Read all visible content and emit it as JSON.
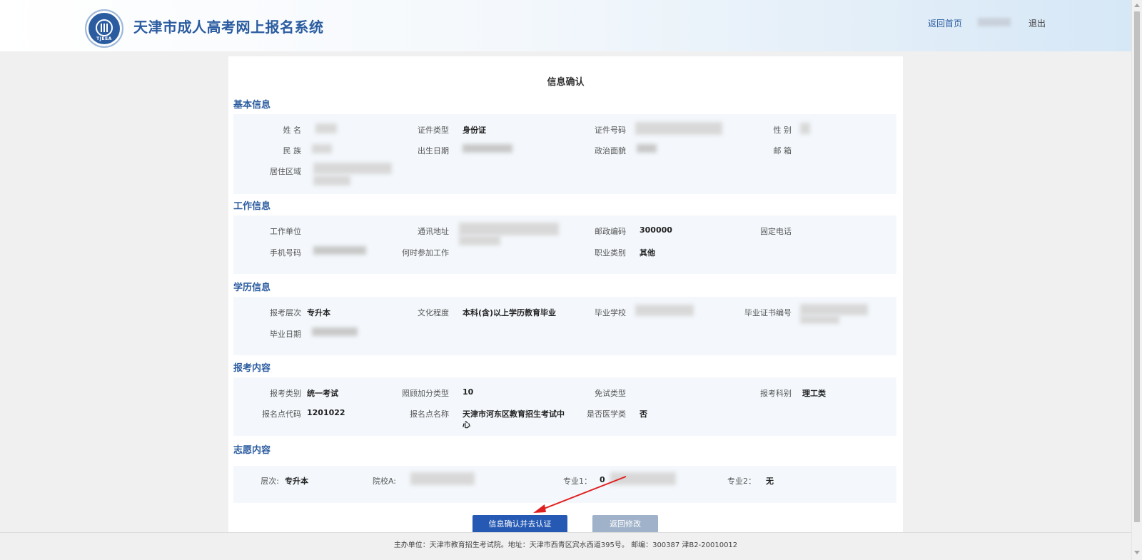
{
  "header": {
    "logo_text": "TJEEA",
    "title": "天津市成人高考网上报名系统",
    "home_link": "返回首页",
    "logout_link": "退出"
  },
  "page_title": "信息确认",
  "basic": {
    "title": "基本信息",
    "name_label": "姓 名",
    "id_type_label": "证件类型",
    "id_type_value": "身份证",
    "id_number_label": "证件号码",
    "gender_label": "性 别",
    "ethnicity_label": "民 族",
    "birth_label": "出生日期",
    "political_label": "政治面貌",
    "email_label": "邮 箱",
    "region_label": "居住区域"
  },
  "work": {
    "title": "工作信息",
    "employer_label": "工作单位",
    "address_label": "通讯地址",
    "postcode_label": "邮政编码",
    "postcode_value": "300000",
    "landline_label": "固定电话",
    "mobile_label": "手机号码",
    "work_start_label": "何时参加工作",
    "occupation_label": "职业类别",
    "occupation_value": "其他"
  },
  "education": {
    "title": "学历信息",
    "level_label": "报考层次",
    "level_value": "专升本",
    "degree_label": "文化程度",
    "degree_value": "本科(含)以上学历教育毕业",
    "school_label": "毕业学校",
    "cert_label": "毕业证书编号",
    "grad_date_label": "毕业日期"
  },
  "exam": {
    "title": "报考内容",
    "category_label": "报考类别",
    "category_value": "统一考试",
    "bonus_label": "照顾加分类型",
    "bonus_value": "10",
    "exempt_label": "免试类型",
    "subject_label": "报考科别",
    "subject_value": "理工类",
    "site_code_label": "报名点代码",
    "site_code_value": "1201022",
    "site_name_label": "报名点名称",
    "site_name_value_line1": "天津市河东区教育招生考试中",
    "site_name_value_line2": "心",
    "medical_label": "是否医学类",
    "medical_value": "否"
  },
  "wish": {
    "title": "志愿内容",
    "level_label": "层次:",
    "level_value": "专升本",
    "school_label": "院校A:",
    "major1_label": "专业1：",
    "major1_prefix": "0",
    "major2_label": "专业2：",
    "major2_value": "无"
  },
  "buttons": {
    "confirm": "信息确认并去认证",
    "back": "返回修改"
  },
  "footer": "主办单位：天津市教育招生考试院。地址：天津市西青区宾水西道395号。 邮编：300387 津B2-20010012"
}
